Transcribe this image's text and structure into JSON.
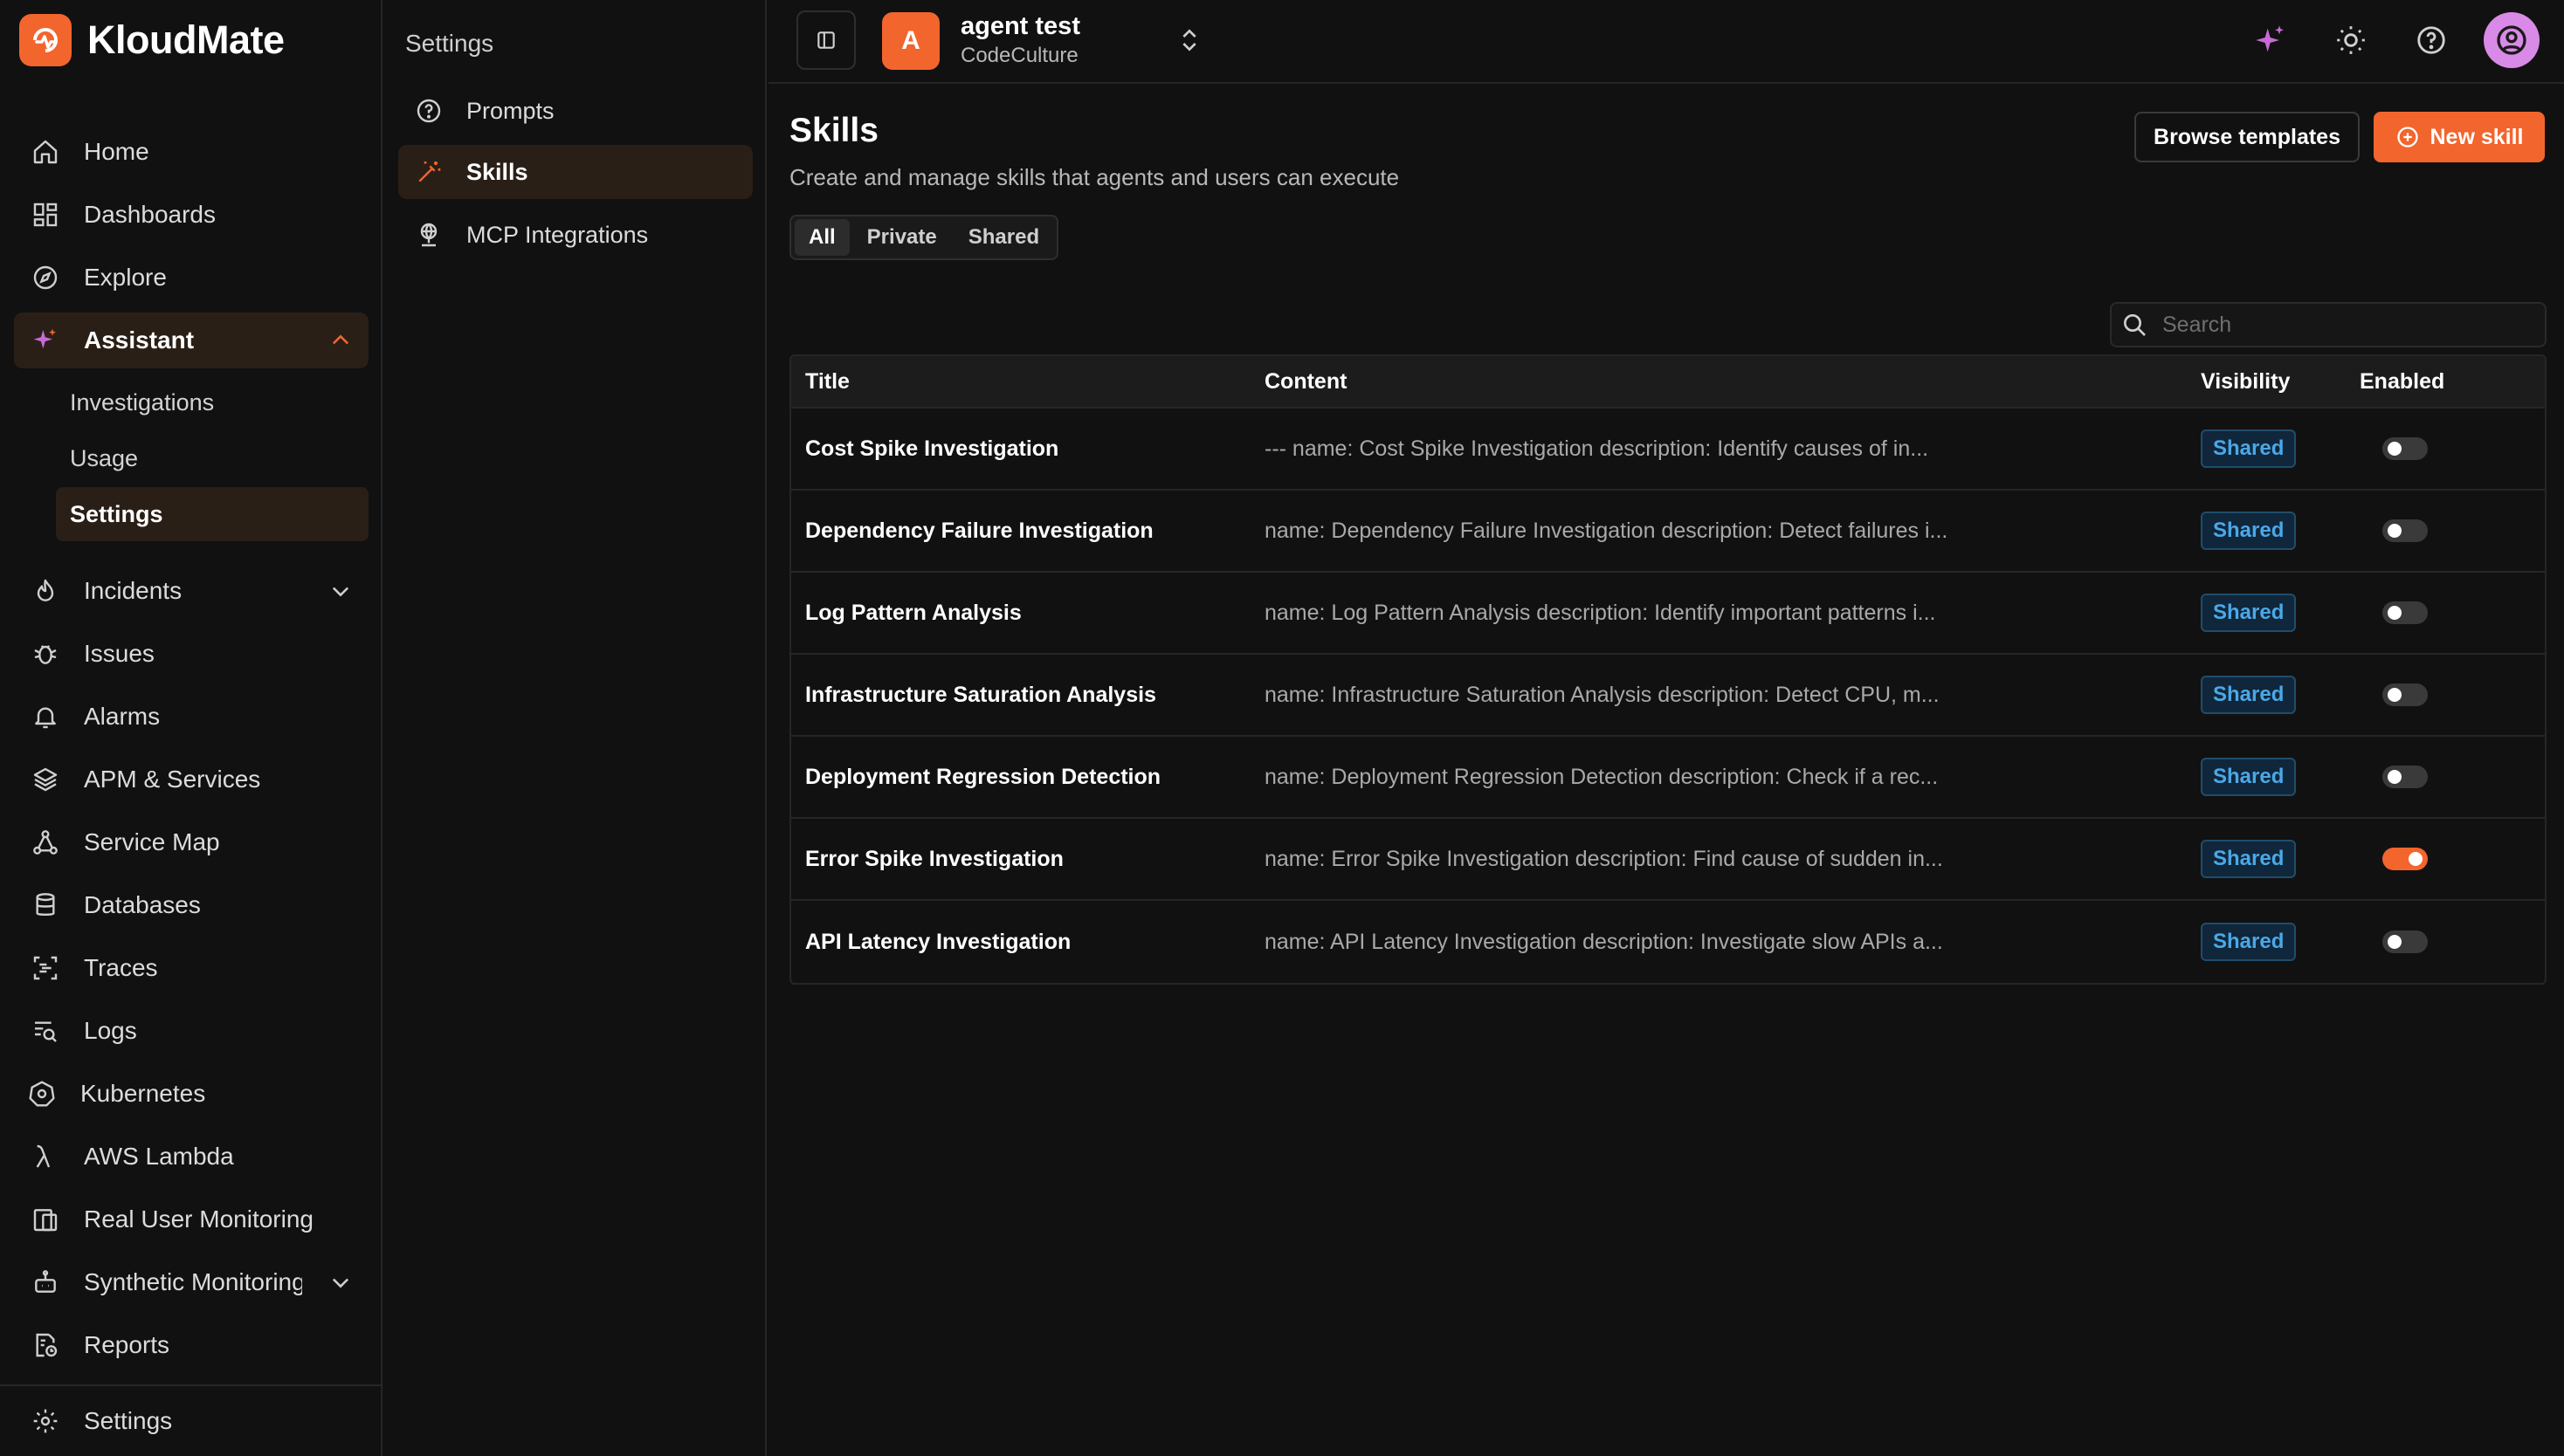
{
  "brand": {
    "name": "KloudMate",
    "accent": "#f2652d"
  },
  "sidebar": {
    "items": [
      {
        "label": "Home",
        "icon": "home-icon"
      },
      {
        "label": "Dashboards",
        "icon": "dashboard-icon"
      },
      {
        "label": "Explore",
        "icon": "compass-icon"
      },
      {
        "label": "Assistant",
        "icon": "sparkle-icon"
      },
      {
        "label": "Incidents",
        "icon": "flame-icon"
      },
      {
        "label": "Issues",
        "icon": "bug-icon"
      },
      {
        "label": "Alarms",
        "icon": "bell-icon"
      },
      {
        "label": "APM & Services",
        "icon": "layers-icon"
      },
      {
        "label": "Service Map",
        "icon": "service-map-icon"
      },
      {
        "label": "Databases",
        "icon": "database-icon"
      },
      {
        "label": "Traces",
        "icon": "traces-icon"
      },
      {
        "label": "Logs",
        "icon": "logs-icon"
      },
      {
        "label": "Kubernetes",
        "icon": "kubernetes-icon"
      },
      {
        "label": "AWS Lambda",
        "icon": "lambda-icon"
      },
      {
        "label": "Real User Monitoring",
        "icon": "rum-icon"
      },
      {
        "label": "Synthetic Monitoring",
        "icon": "robot-icon"
      },
      {
        "label": "Reports",
        "icon": "reports-icon"
      }
    ],
    "assistant_sub": [
      "Investigations",
      "Usage",
      "Settings"
    ],
    "footer_settings": "Settings"
  },
  "subpanel": {
    "title": "Settings",
    "items": [
      {
        "label": "Prompts",
        "icon": "question-circle-icon"
      },
      {
        "label": "Skills",
        "icon": "magic-wand-icon"
      },
      {
        "label": "MCP Integrations",
        "icon": "globe-network-icon"
      }
    ]
  },
  "topbar": {
    "org_initial": "A",
    "org_name": "agent test",
    "org_sub": "CodeCulture"
  },
  "main": {
    "title": "Skills",
    "subtitle": "Create and manage skills that agents and users can execute",
    "browse_label": "Browse templates",
    "new_label": "New skill",
    "filters": [
      "All",
      "Private",
      "Shared"
    ],
    "active_filter": "All",
    "search_placeholder": "Search",
    "columns": [
      "Title",
      "Content",
      "Visibility",
      "Enabled"
    ],
    "rows": [
      {
        "title": "Cost Spike Investigation",
        "content": "--- name: Cost Spike Investigation description: Identify causes of in...",
        "visibility": "Shared",
        "enabled": false
      },
      {
        "title": "Dependency Failure Investigation",
        "content": "name: Dependency Failure Investigation description: Detect failures i...",
        "visibility": "Shared",
        "enabled": false
      },
      {
        "title": "Log Pattern Analysis",
        "content": "name: Log Pattern Analysis description: Identify important patterns i...",
        "visibility": "Shared",
        "enabled": false
      },
      {
        "title": "Infrastructure Saturation Analysis",
        "content": "name: Infrastructure Saturation Analysis description: Detect CPU, m...",
        "visibility": "Shared",
        "enabled": false
      },
      {
        "title": "Deployment Regression Detection",
        "content": "name: Deployment Regression Detection description: Check if a rec...",
        "visibility": "Shared",
        "enabled": false
      },
      {
        "title": "Error Spike Investigation",
        "content": "name: Error Spike Investigation description: Find cause of sudden in...",
        "visibility": "Shared",
        "enabled": true
      },
      {
        "title": "API Latency Investigation",
        "content": "name: API Latency Investigation description: Investigate slow APIs a...",
        "visibility": "Shared",
        "enabled": false
      }
    ]
  }
}
